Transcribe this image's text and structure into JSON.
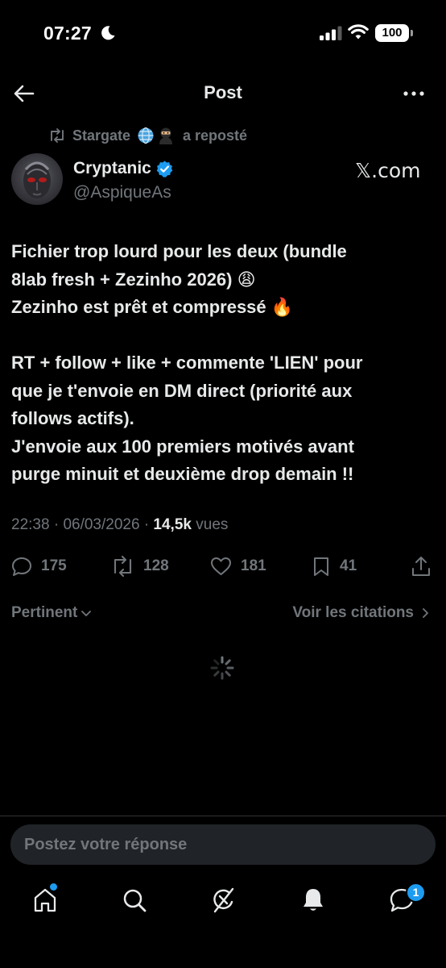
{
  "status_bar": {
    "time": "07:27",
    "battery": "100"
  },
  "header": {
    "title": "Post"
  },
  "repost": {
    "user": "Stargate",
    "suffix": "a reposté"
  },
  "author": {
    "name": "Cryptanic",
    "handle": "@AspiqueAs",
    "source_link": "𝕏.com"
  },
  "tweet": {
    "lines": [
      "Fichier trop lourd pour les deux (bundle",
      "8lab fresh + Zezinho 2026) 😩",
      "Zezinho est prêt et compressé 🔥",
      "",
      "RT + follow + like + commente 'LIEN' pour",
      "que je t'envoie en DM direct (priorité aux",
      "follows actifs).",
      "J'envoie aux 100 premiers motivés avant",
      "purge minuit et deuxième drop demain !!"
    ]
  },
  "meta": {
    "time": "22:38",
    "date": "06/03/2026",
    "views": "14,5k",
    "views_label": "vues"
  },
  "actions": {
    "replies": "175",
    "reposts": "128",
    "likes": "181",
    "bookmarks": "41"
  },
  "sort": {
    "label": "Pertinent",
    "citations": "Voir les citations"
  },
  "reply_box": {
    "placeholder": "Postez votre réponse"
  },
  "tab_bar": {
    "messages_badge": "1"
  },
  "colors": {
    "accent": "#1d9bf0",
    "muted": "#71767b",
    "text": "#e7e9ea",
    "background": "#000000"
  },
  "icons": [
    "moon-icon",
    "signal-icon",
    "wifi-icon",
    "back-arrow-icon",
    "more-icon",
    "repost-icon",
    "verified-icon",
    "reply-icon",
    "like-icon",
    "bookmark-icon",
    "share-icon",
    "chevron-down-icon",
    "chevron-right-icon",
    "spinner-icon",
    "home-icon",
    "search-icon",
    "grok-icon",
    "bell-icon",
    "messages-icon"
  ]
}
